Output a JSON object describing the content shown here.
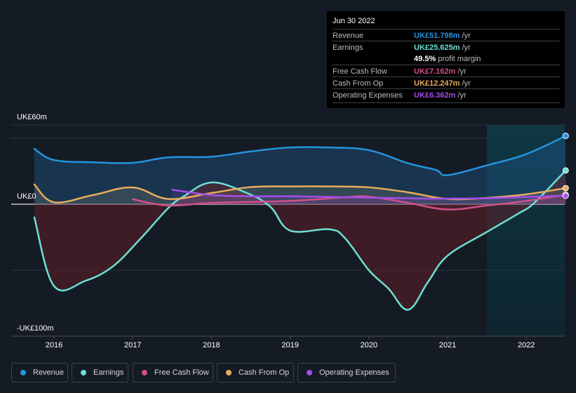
{
  "tooltip": {
    "date": "Jun 30 2022",
    "rows": [
      {
        "label": "Revenue",
        "value": "UK£51.798m",
        "unit": " /yr",
        "color": "#2394df"
      },
      {
        "label": "Earnings",
        "value": "UK£25.625m",
        "unit": " /yr",
        "color": "#6ce0d2"
      },
      {
        "label": "",
        "value": "49.5%",
        "unit": " profit margin",
        "color": "#ffffff"
      },
      {
        "label": "Free Cash Flow",
        "value": "UK£7.162m",
        "unit": " /yr",
        "color": "#d0508a"
      },
      {
        "label": "Cash From Op",
        "value": "UK£12.247m",
        "unit": " /yr",
        "color": "#e8ad5c"
      },
      {
        "label": "Operating Expenses",
        "value": "UK£6.362m",
        "unit": " /yr",
        "color": "#a54ee8"
      }
    ]
  },
  "legend": [
    {
      "label": "Revenue",
      "color": "#2394df"
    },
    {
      "label": "Earnings",
      "color": "#6ce0d2"
    },
    {
      "label": "Free Cash Flow",
      "color": "#d0508a"
    },
    {
      "label": "Cash From Op",
      "color": "#e8ad5c"
    },
    {
      "label": "Operating Expenses",
      "color": "#a54ee8"
    }
  ],
  "chart_data": {
    "type": "line",
    "title": "",
    "xlabel": "",
    "ylabel": "",
    "ylim": [
      -100,
      60
    ],
    "xlim": [
      2015.45,
      2022.5
    ],
    "y_tick_labels": [
      {
        "value": 60,
        "label": "UK£60m"
      },
      {
        "value": 0,
        "label": "UK£0"
      },
      {
        "value": -100,
        "label": "-UK£100m"
      }
    ],
    "gridlines": [
      60,
      50,
      0,
      -50
    ],
    "x_tick_labels": [
      "2016",
      "2017",
      "2018",
      "2019",
      "2020",
      "2021",
      "2022"
    ],
    "x_ticks": [
      2016,
      2017,
      2018,
      2019,
      2020,
      2021,
      2022
    ],
    "highlight_from": 2021.5,
    "series": [
      {
        "name": "Revenue",
        "color": "#2394df",
        "x": [
          2015.75,
          2016.0,
          2016.5,
          2017.0,
          2017.45,
          2018.0,
          2018.5,
          2019.0,
          2019.5,
          2020.0,
          2020.5,
          2020.85,
          2021.0,
          2021.5,
          2022.0,
          2022.5
        ],
        "y": [
          42,
          33.5,
          31.8,
          31.4,
          35.5,
          36,
          40,
          43,
          43,
          41,
          31,
          26,
          22,
          29.5,
          38,
          51.8
        ]
      },
      {
        "name": "Earnings",
        "color": "#6ce0d2",
        "x": [
          2015.75,
          2016.0,
          2016.4,
          2016.75,
          2017.1,
          2017.45,
          2017.65,
          2018.0,
          2018.45,
          2018.75,
          2019.0,
          2019.5,
          2019.7,
          2020.0,
          2020.25,
          2020.5,
          2020.75,
          2021.0,
          2021.5,
          2021.9,
          2022.1,
          2022.5
        ],
        "y": [
          -10,
          -62,
          -58,
          -47,
          -26,
          -3,
          6,
          16.5,
          8.5,
          -2,
          -20,
          -19,
          -26,
          -50,
          -64,
          -80,
          -59,
          -39,
          -21,
          -7,
          1,
          25.6
        ]
      },
      {
        "name": "Free Cash Flow",
        "color": "#d0508a",
        "x": [
          2017.0,
          2017.45,
          2018.0,
          2019.0,
          2019.7,
          2020.0,
          2020.5,
          2021.0,
          2021.5,
          2022.0,
          2022.5
        ],
        "y": [
          3.8,
          -1,
          1,
          2.5,
          5.3,
          5.8,
          1,
          -4,
          -1,
          2.5,
          7.2
        ]
      },
      {
        "name": "Cash From Op",
        "color": "#e8ad5c",
        "x": [
          2015.75,
          2016.0,
          2016.5,
          2017.0,
          2017.45,
          2018.0,
          2018.5,
          2019.0,
          2019.5,
          2020.0,
          2020.5,
          2021.0,
          2021.5,
          2022.0,
          2022.5
        ],
        "y": [
          15,
          1.5,
          7,
          12.7,
          4,
          8.5,
          13,
          13.5,
          13.5,
          12.8,
          9,
          4,
          4.8,
          7.5,
          12.2
        ]
      },
      {
        "name": "Operating Expenses",
        "color": "#a54ee8",
        "x": [
          2017.5,
          2018.0,
          2018.5,
          2019.0,
          2019.5,
          2020.0,
          2020.5,
          2021.0,
          2021.5,
          2022.0,
          2022.5
        ],
        "y": [
          11,
          7,
          6,
          6,
          5.5,
          5,
          4.5,
          4.2,
          4.5,
          5.5,
          6.4
        ]
      }
    ]
  }
}
